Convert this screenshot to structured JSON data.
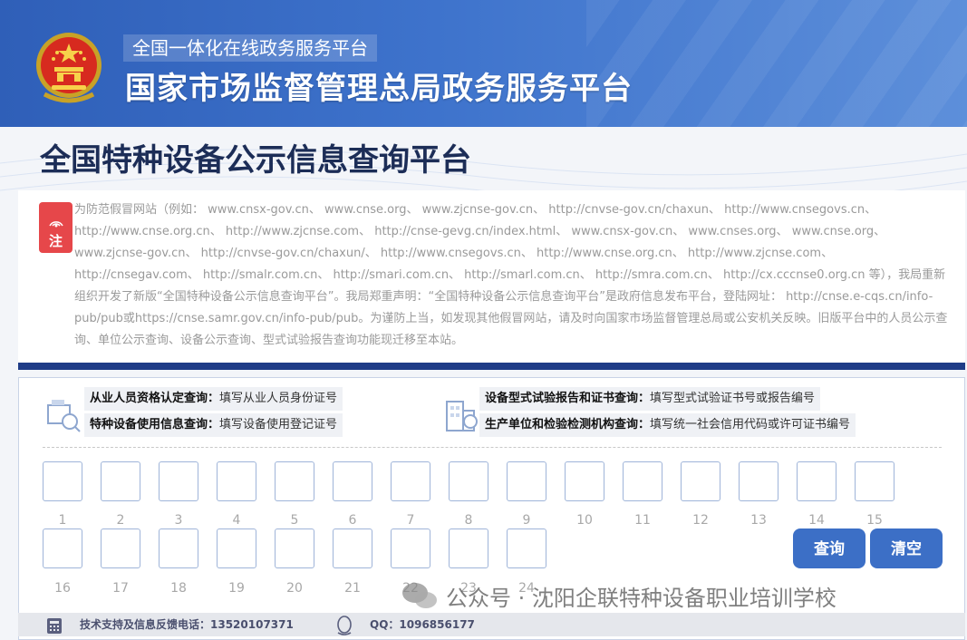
{
  "header": {
    "subtitle": "全国一体化在线政务服务平台",
    "title": "国家市场监督管理总局政务服务平台"
  },
  "page_title": "全国特种设备公示信息查询平台",
  "notice": {
    "badge": "注",
    "text": "为防范假冒网站（例如： www.cnsx-gov.cn、 www.cnse.org、 www.zjcnse-gov.cn、 http://cnvse-gov.cn/chaxun、 http://www.cnsegovs.cn、 http://www.cnse.org.cn、 http://www.zjcnse.com、 http://cnse-gevg.cn/index.html、 www.cnsx-gov.cn、 www.cnses.org、 www.cnse.org、 www.zjcnse-gov.cn、 http://cnvse-gov.cn/chaxun/、 http://www.cnsegovs.cn、 http://www.cnse.org.cn、 http://www.zjcnse.com、 http://cnsegav.com、 http://smalr.com.cn、 http://smari.com.cn、 http://smarl.com.cn、 http://smra.com.cn、 http://cx.cccnse0.org.cn 等），我局重新组织开发了新版“全国特种设备公示信息查询平台”。我局郑重声明：“全国特种设备公示信息查询平台”是政府信息发布平台，登陆网址： http://cnse.e-cqs.cn/info-pub/pub或https://cnse.samr.gov.cn/info-pub/pub。为谨防上当，如发现其他假冒网站，请及时向国家市场监督管理总局或公安机关反映。旧版平台中的人员公示查询、单位公示查询、设备公示查询、型式试验报告查询功能现迁移至本站。"
  },
  "query": {
    "left": [
      {
        "label": "从业人员资格认定查询：",
        "hint": "填写从业人员身份证号"
      },
      {
        "label": "特种设备使用信息查询：",
        "hint": "填写设备使用登记证号"
      }
    ],
    "right": [
      {
        "label": "设备型式试验报告和证书查询：",
        "hint": "填写型式试验证书号或报告编号"
      },
      {
        "label": "生产单位和检验检测机构查询：",
        "hint": "填写统一社会信用代码或许可证书编号"
      }
    ],
    "row1": [
      "1",
      "2",
      "3",
      "4",
      "5",
      "6",
      "7",
      "8",
      "9",
      "10",
      "11",
      "12",
      "13",
      "14",
      "15"
    ],
    "row2": [
      "16",
      "17",
      "18",
      "19",
      "20",
      "21",
      "22",
      "23",
      "24"
    ],
    "search_label": "查询",
    "clear_label": "清空"
  },
  "footer": {
    "phone": "技术支持及信息反馈电话：13520107371",
    "qq": "QQ：1096856177"
  },
  "watermark": "公众号 · 沈阳企联特种设备职业培训学校"
}
